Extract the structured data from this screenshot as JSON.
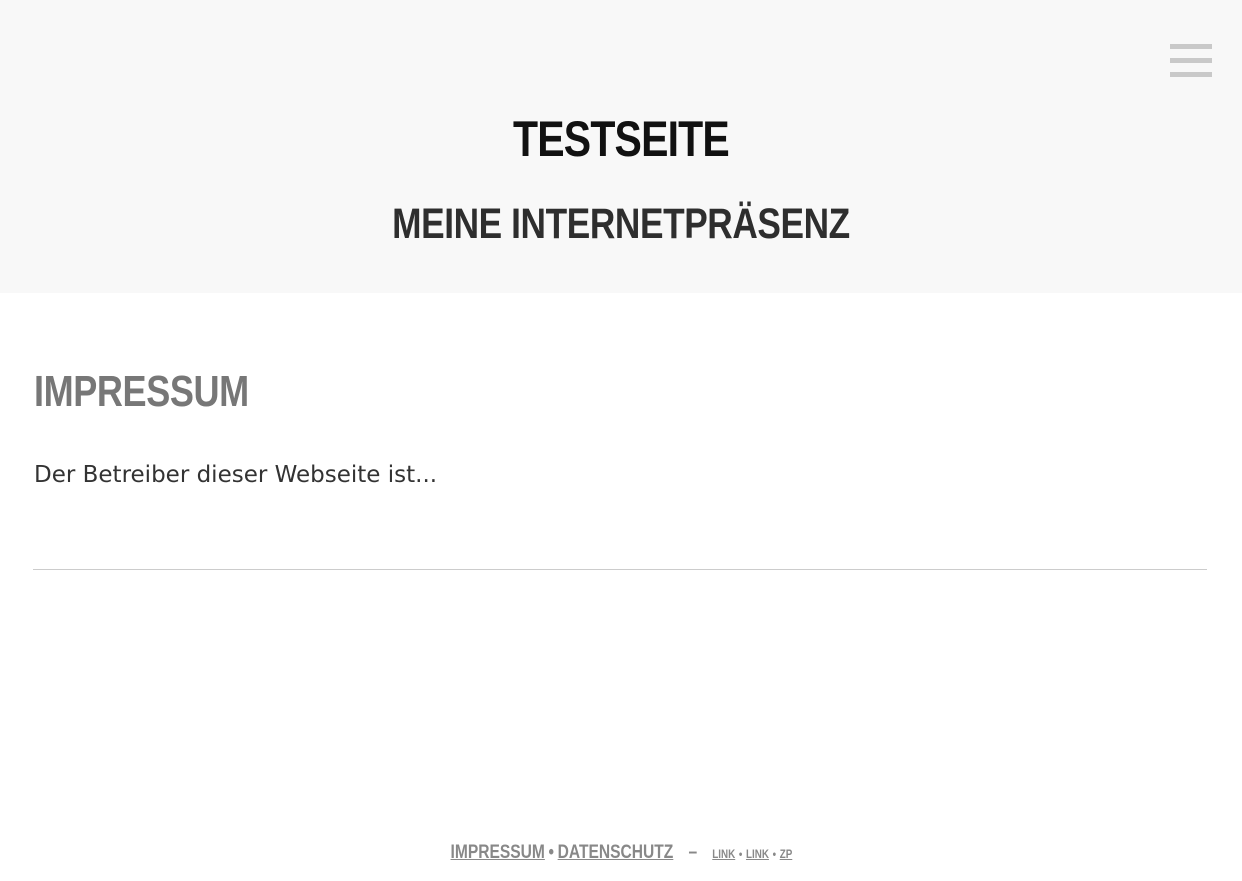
{
  "header": {
    "title": "TESTSEITE",
    "subtitle": "MEINE INTERNETPRÄSENZ",
    "menu_icon": "hamburger-menu-icon"
  },
  "main": {
    "heading": "IMPRESSUM",
    "text": "Der Betreiber dieser Webseite ist..."
  },
  "footer": {
    "primary_links": [
      "IMPRESSUM",
      "DATENSCHUTZ"
    ],
    "separator": "•",
    "dash": "–",
    "secondary_links": [
      "LINK",
      "LINK",
      "ZP"
    ]
  },
  "colors": {
    "header_bg": "#f8f8f8",
    "title": "#111111",
    "heading": "#777777",
    "footer_link": "#888888",
    "menu_bars": "#c9c9c9",
    "divider": "#cccccc"
  }
}
